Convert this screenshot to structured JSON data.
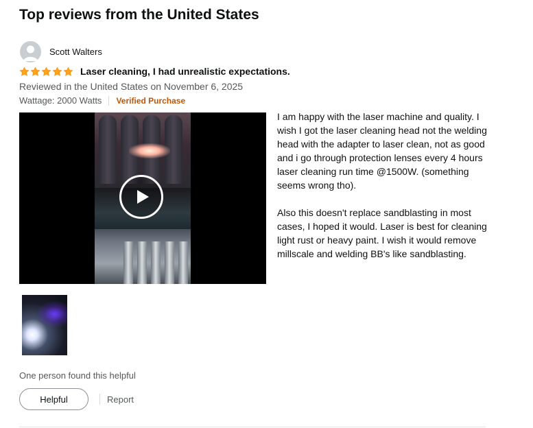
{
  "section": {
    "title": "Top reviews from the United States"
  },
  "review": {
    "author": "Scott Walters",
    "rating": 5,
    "rating_max": 5,
    "star_color": "#ffa41c",
    "title": "Laser cleaning, I had unrealistic expectations.",
    "date_line": "Reviewed in the United States on November 6, 2025",
    "variant": "Wattage: 2000 Watts",
    "verified_label": "Verified Purchase",
    "verified_color": "#c45500",
    "body": [
      "I am happy with the laser machine and quality. I wish I got the laser cleaning head not the welding head with the adapter to laser clean, not as good and i go through protection lenses every 4 hours laser cleaning run time @1500W. (something seems wrong tho).",
      "Also this doesn't replace sandblasting in most cases, I hoped it would. Laser is best for cleaning light rust or heavy paint. I wish it would remove millscale and welding BB's like sandblasting."
    ],
    "media": {
      "video_icon": "play-icon",
      "thumbnail_count": 1
    },
    "helpful_count_text": "One person found this helpful",
    "helpful_button": "Helpful",
    "report_link": "Report"
  }
}
